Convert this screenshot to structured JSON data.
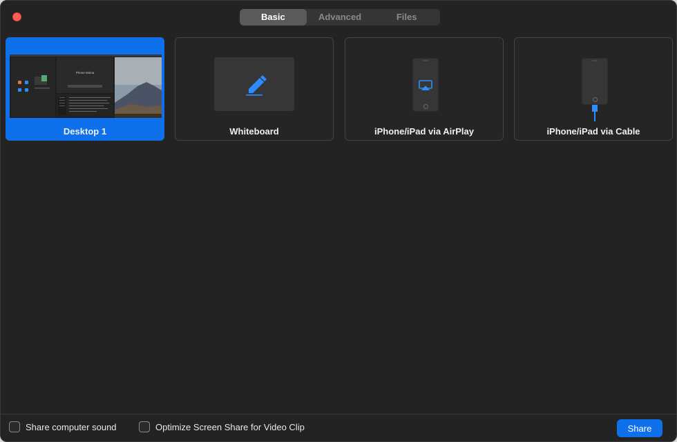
{
  "window": {
    "close_icon": "close-icon"
  },
  "tabs": [
    {
      "label": "Basic",
      "active": true
    },
    {
      "label": "Advanced",
      "active": false
    },
    {
      "label": "Files",
      "active": false
    }
  ],
  "cards": [
    {
      "label": "Desktop 1",
      "selected": true,
      "icon": "desktop-thumbnail"
    },
    {
      "label": "Whiteboard",
      "selected": false,
      "icon": "pencil-icon"
    },
    {
      "label": "iPhone/iPad via AirPlay",
      "selected": false,
      "icon": "airplay-icon"
    },
    {
      "label": "iPhone/iPad via Cable",
      "selected": false,
      "icon": "cable-icon"
    }
  ],
  "desktop_preview": {
    "window_title": "Phone Minna"
  },
  "footer": {
    "share_sound_label": "Share computer sound",
    "optimize_label": "Optimize Screen Share for Video Clip",
    "share_button": "Share"
  },
  "colors": {
    "accent": "#0e71eb",
    "background": "#232323",
    "close": "#fe5f57"
  }
}
